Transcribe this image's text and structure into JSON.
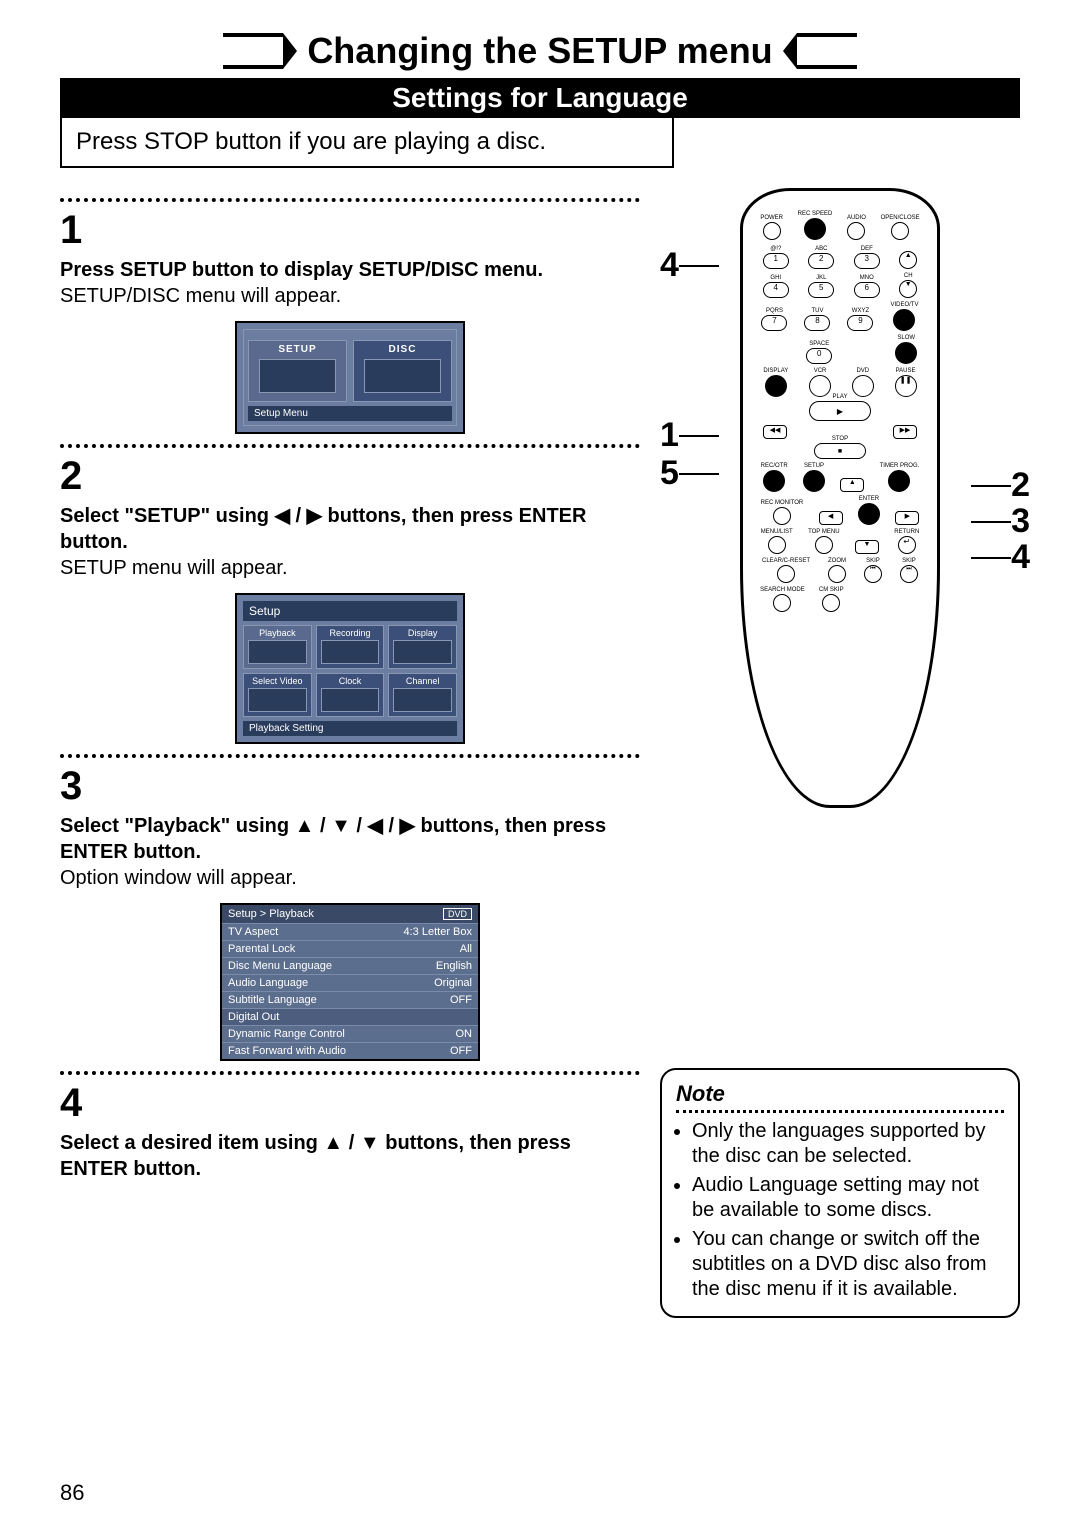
{
  "title": "Changing the SETUP menu",
  "subtitle": "Settings for Language",
  "intro_instruction": "Press STOP button if you are playing a disc.",
  "steps": {
    "s1": {
      "num": "1",
      "bold": "Press SETUP button to display SETUP/DISC menu.",
      "plain": "SETUP/DISC menu will appear.",
      "screen": {
        "tile_setup": "SETUP",
        "tile_disc": "DISC",
        "footer": "Setup Menu"
      }
    },
    "s2": {
      "num": "2",
      "bold": "Select \"SETUP\" using ◀ / ▶ buttons, then press ENTER button.",
      "plain": "SETUP menu will appear.",
      "screen": {
        "header": "Setup",
        "tiles": [
          "Playback",
          "Recording",
          "Display",
          "Select Video",
          "Clock",
          "Channel"
        ],
        "footer": "Playback Setting"
      }
    },
    "s3": {
      "num": "3",
      "bold": "Select \"Playback\" using ▲ / ▼ / ◀ / ▶ buttons, then press ENTER button.",
      "plain": "Option window will appear.",
      "screen": {
        "breadcrumb": "Setup > Playback",
        "badge": "DVD",
        "rows": [
          {
            "k": "TV Aspect",
            "v": "4:3 Letter Box"
          },
          {
            "k": "Parental Lock",
            "v": "All"
          },
          {
            "k": "Disc Menu Language",
            "v": "English"
          },
          {
            "k": "Audio Language",
            "v": "Original"
          },
          {
            "k": "Subtitle Language",
            "v": "OFF"
          },
          {
            "k": "Digital Out",
            "v": ""
          },
          {
            "k": "Dynamic Range Control",
            "v": "ON"
          },
          {
            "k": "Fast Forward with Audio",
            "v": "OFF"
          }
        ]
      }
    },
    "s4": {
      "num": "4",
      "bold": "Select a desired item using ▲ / ▼ buttons, then press ENTER button."
    }
  },
  "remote": {
    "row1": [
      "POWER",
      "REC SPEED",
      "AUDIO",
      "OPEN/CLOSE"
    ],
    "numpad_top_labels": [
      "@!?",
      "ABC",
      "DEF"
    ],
    "numpad_r1": [
      "1",
      "2",
      "3"
    ],
    "numpad_r2_labels": [
      "GHI",
      "JKL",
      "MNO",
      "CH"
    ],
    "numpad_r2": [
      "4",
      "5",
      "6"
    ],
    "numpad_r3_labels": [
      "PQRS",
      "TUV",
      "WXYZ",
      "VIDEO/TV"
    ],
    "numpad_r3": [
      "7",
      "8",
      "9"
    ],
    "row_space": [
      "",
      "SPACE",
      "",
      "SLOW"
    ],
    "row_space_btn": "0",
    "row_dvp": [
      "DISPLAY",
      "VCR",
      "DVD",
      "PAUSE"
    ],
    "play_label": "PLAY",
    "rew": "◀◀",
    "ff": "▶▶",
    "stop_label": "STOP",
    "row_rec": [
      "REC/OTR",
      "SETUP",
      "",
      "TIMER PROG."
    ],
    "row_enter": [
      "REC MONITOR",
      "",
      "ENTER",
      ""
    ],
    "row_menu": [
      "MENU/LIST",
      "TOP MENU",
      "",
      "RETURN"
    ],
    "row_zoom": [
      "CLEAR/C-RESET",
      "ZOOM",
      "SKIP",
      "SKIP"
    ],
    "row_last": [
      "SEARCH MODE",
      "CM SKIP",
      "",
      ""
    ]
  },
  "callouts": {
    "left": [
      "4",
      "1",
      "5"
    ],
    "right": [
      "2",
      "3",
      "4"
    ]
  },
  "note": {
    "heading": "Note",
    "items": [
      "Only the languages supported by the disc can be selected.",
      "Audio Language setting may not be available to some discs.",
      "You can change or switch off the subtitles on a DVD disc also from the disc menu if it is available."
    ]
  },
  "page_number": "86"
}
